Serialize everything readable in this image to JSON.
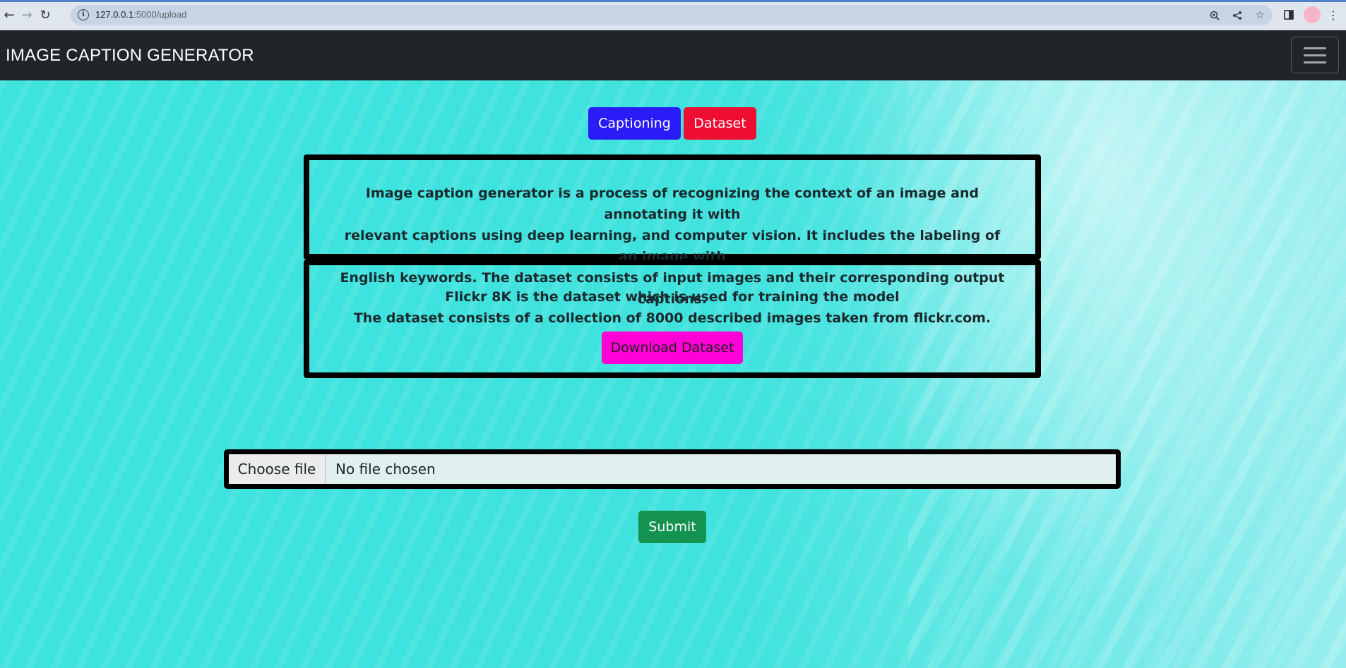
{
  "browser": {
    "url_host": "127.0.0.1",
    "url_path": ":5000/upload",
    "icons": [
      "back-arrow-icon",
      "forward-arrow-icon",
      "reload-icon",
      "site-info-icon",
      "zoom-icon",
      "share-icon",
      "bookmark-star-icon",
      "side-panel-icon",
      "profile-avatar-icon",
      "kebab-menu-icon"
    ]
  },
  "navbar": {
    "brand": "IMAGE CAPTION GENERATOR",
    "toggler_icon": "hamburger-icon"
  },
  "nav_buttons": {
    "captioning": "Captioning",
    "dataset": "Dataset"
  },
  "intro": {
    "line1": "Image caption generator is a process of recognizing the context of an image and annotating it with",
    "line2": "relevant captions using deep learning, and computer vision. It includes the labeling of an image with",
    "line3": "English keywords. The dataset consists of input images and their corresponding output captions."
  },
  "dataset_info": {
    "line1": "Flickr 8K is the dataset which is used for training the model",
    "line2": "The dataset consists of a collection of 8000 described images taken from flickr.com.",
    "download_label": "Download Dataset"
  },
  "upload": {
    "choose_label": "Choose file",
    "status": "No file chosen",
    "submit_label": "Submit"
  },
  "colors": {
    "navbar": "#212529",
    "captioning_btn": "#2a1cf7",
    "dataset_btn": "#ee0e31",
    "download_btn": "#ff00d6",
    "submit_btn": "#14924f",
    "background": "#3fe3e0"
  }
}
